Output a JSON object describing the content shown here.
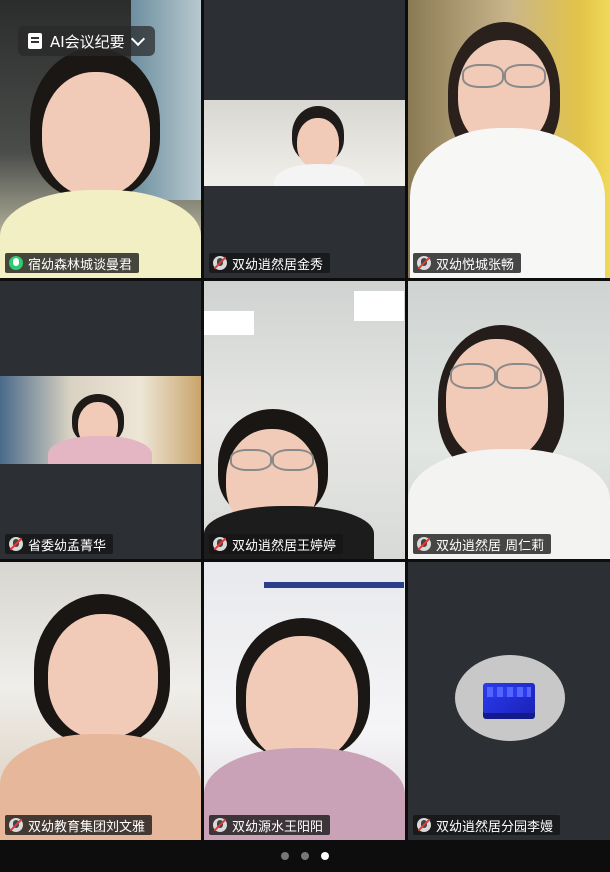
{
  "toolbar": {
    "ai_button_label": "AI会议纪要",
    "ai_icon": "document-icon",
    "chevron_icon": "chevron-down-icon"
  },
  "participants": [
    {
      "name": "宿幼森林城谈曼君",
      "mic": "active"
    },
    {
      "name": "双幼逍然居金秀",
      "mic": "muted"
    },
    {
      "name": "双幼悦城张畅",
      "mic": "muted"
    },
    {
      "name": "省委幼孟菁华",
      "mic": "muted"
    },
    {
      "name": "双幼逍然居王婷婷",
      "mic": "muted"
    },
    {
      "name": "双幼逍然居 周仁莉",
      "mic": "muted"
    },
    {
      "name": "双幼教育集团刘文雅",
      "mic": "muted"
    },
    {
      "name": "双幼源水王阳阳",
      "mic": "muted"
    },
    {
      "name": "双幼逍然居分园李嫚",
      "mic": "muted"
    }
  ],
  "pagination": {
    "pages": 3,
    "current": 3
  },
  "colors": {
    "mic_active": "#2ecc71",
    "mic_muted_slash": "#e53935",
    "avatar_cube": "#2b3cf0"
  }
}
